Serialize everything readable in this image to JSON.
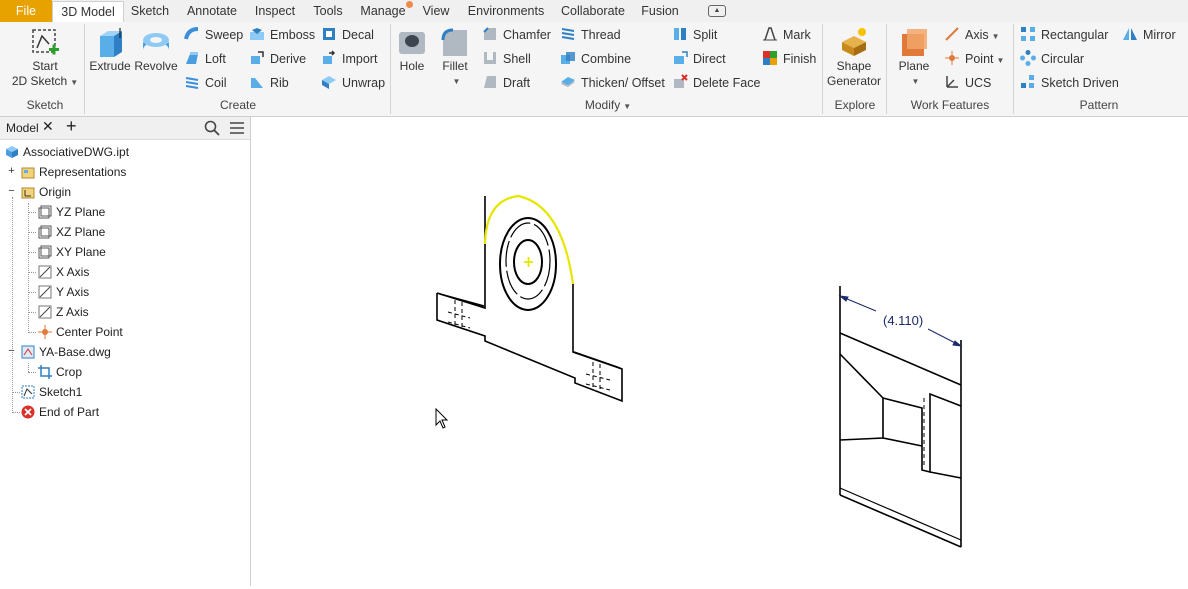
{
  "tabs": [
    {
      "label": "File"
    },
    {
      "label": "3D Model"
    },
    {
      "label": "Sketch"
    },
    {
      "label": "Annotate"
    },
    {
      "label": "Inspect"
    },
    {
      "label": "Tools"
    },
    {
      "label": "Manage"
    },
    {
      "label": "View"
    },
    {
      "label": "Environments"
    },
    {
      "label": "Collaborate"
    },
    {
      "label": "Fusion"
    }
  ],
  "ribbon": {
    "sketch": {
      "title": "Sketch",
      "start_line1": "Start",
      "start_line2": "2D Sketch"
    },
    "create": {
      "title": "Create",
      "extrude": "Extrude",
      "revolve": "Revolve",
      "sweep": "Sweep",
      "loft": "Loft",
      "coil": "Coil",
      "emboss": "Emboss",
      "derive": "Derive",
      "rib": "Rib",
      "decal": "Decal",
      "import": "Import",
      "unwrap": "Unwrap"
    },
    "modify": {
      "title": "Modify",
      "hole": "Hole",
      "fillet": "Fillet",
      "chamfer": "Chamfer",
      "shell": "Shell",
      "draft": "Draft",
      "thread": "Thread",
      "combine": "Combine",
      "thicken": "Thicken/ Offset",
      "split": "Split",
      "direct": "Direct",
      "delete_face": "Delete Face",
      "mark": "Mark",
      "finish": "Finish"
    },
    "explore": {
      "title": "Explore",
      "shape_line1": "Shape",
      "shape_line2": "Generator"
    },
    "work": {
      "title": "Work Features",
      "plane": "Plane",
      "axis": "Axis",
      "point": "Point",
      "ucs": "UCS"
    },
    "pattern": {
      "title": "Pattern",
      "rectangular": "Rectangular",
      "circular": "Circular",
      "sketch_driven": "Sketch Driven",
      "mirror": "Mirror"
    }
  },
  "browser": {
    "tab_label": "Model",
    "tree": {
      "root": "AssociativeDWG.ipt",
      "representations": "Representations",
      "origin": "Origin",
      "yz": "YZ Plane",
      "xz": "XZ Plane",
      "xy": "XY Plane",
      "x_axis": "X Axis",
      "y_axis": "Y Axis",
      "z_axis": "Z Axis",
      "center": "Center Point",
      "dwg": "YA-Base.dwg",
      "crop": "Crop",
      "sketch1": "Sketch1",
      "end": "End of Part"
    }
  },
  "canvas": {
    "dimension_text": "(4.110)"
  },
  "colors": {
    "file_tab": "#e8a200",
    "selection_highlight": "#e6e600",
    "dimension": "#1a2a6c",
    "error_icon": "#d9302a"
  }
}
